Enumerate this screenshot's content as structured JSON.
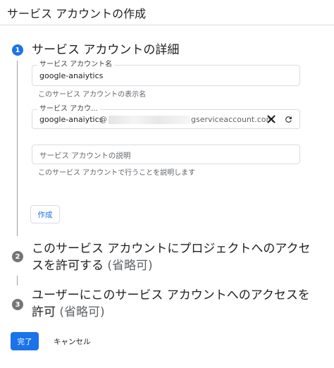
{
  "header": {
    "title": "サービス アカウントの作成"
  },
  "steps": [
    {
      "number": "1",
      "title": "サービス アカウントの詳細"
    },
    {
      "number": "2",
      "title_line1": "このサービス アカウントにプロジェクトへのアクセ",
      "title_line2": "スを許可する",
      "optional": "(省略可)"
    },
    {
      "number": "3",
      "title_line1": "ユーザーにこのサービス アカウントへのアクセスを",
      "title_line2": "許可",
      "optional": "(省略可)"
    }
  ],
  "form": {
    "name_field": {
      "label": "サービス アカウント名",
      "value": "google-anaiytics",
      "hint": "このサービス アカウントの表示名"
    },
    "id_field": {
      "label": "サービス アカウ...",
      "value": "google-anaiytics",
      "at": "@",
      "domain_suffix": "gserviceaccount.com",
      "clear_icon": "close-icon",
      "refresh_icon": "refresh-icon"
    },
    "description_field": {
      "placeholder": "サービス アカウントの説明",
      "hint": "このサービス アカウントで行うことを説明します"
    },
    "create_button": "作成"
  },
  "footer": {
    "done_button": "完了",
    "cancel_button": "キャンセル"
  },
  "colors": {
    "accent": "#1a73e8",
    "step_inactive": "#757575",
    "border": "#dadce0"
  }
}
